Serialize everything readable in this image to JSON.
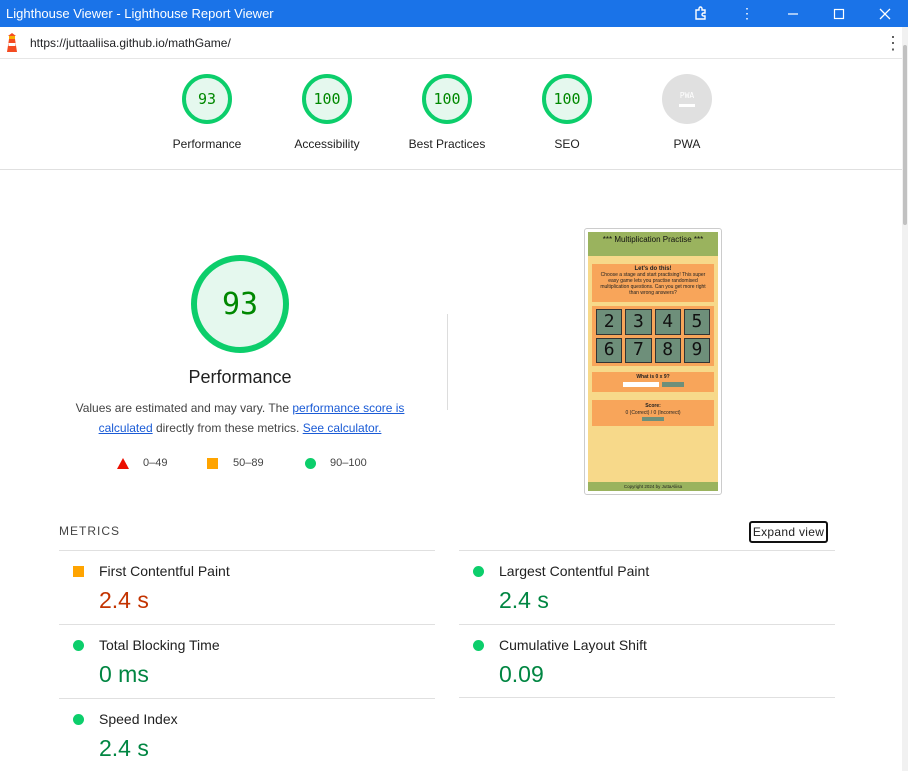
{
  "window": {
    "title": "Lighthouse Viewer - Lighthouse Report Viewer",
    "url": "https://juttaaliisa.github.io/mathGame/"
  },
  "summary_gauges": [
    {
      "label": "Performance",
      "score": "93"
    },
    {
      "label": "Accessibility",
      "score": "100"
    },
    {
      "label": "Best Practices",
      "score": "100"
    },
    {
      "label": "SEO",
      "score": "100"
    },
    {
      "label": "PWA",
      "score": "PWA"
    }
  ],
  "performance": {
    "score": "93",
    "title": "Performance",
    "desc_1": "Values are estimated and may vary. The",
    "link_1": "performance score is calculated",
    "desc_2": "directly from these metrics.",
    "link_2": "See calculator.",
    "legend": [
      "0–49",
      "50–89",
      "90–100"
    ]
  },
  "screenshot": {
    "header": "*** Multiplication Practise ***",
    "intro_title": "Let's do this!",
    "intro_text": "Choose a stage and start practising! This super easy game lets you practise randomised multiplication questions. Can you get more right than wrong answers?",
    "numbers": [
      "2",
      "3",
      "4",
      "5",
      "6",
      "7",
      "8",
      "9"
    ],
    "question": "What is 0 x 9?",
    "input_placeholder": "Your answer",
    "submit": "Submit Answer",
    "score_title": "Score:",
    "score_text": "0 (Correct) / 0 (Incorrect)",
    "reset": "Reset score",
    "footer": "Copyright 2024 by JuttaAliisa"
  },
  "metrics": {
    "heading": "METRICS",
    "expand_label": "Expand view",
    "items": [
      {
        "name": "First Contentful Paint",
        "value": "2.4 s",
        "status": "orange"
      },
      {
        "name": "Largest Contentful Paint",
        "value": "2.4 s",
        "status": "green"
      },
      {
        "name": "Total Blocking Time",
        "value": "0 ms",
        "status": "green"
      },
      {
        "name": "Cumulative Layout Shift",
        "value": "0.09",
        "status": "green"
      },
      {
        "name": "Speed Index",
        "value": "2.4 s",
        "status": "green"
      }
    ]
  }
}
